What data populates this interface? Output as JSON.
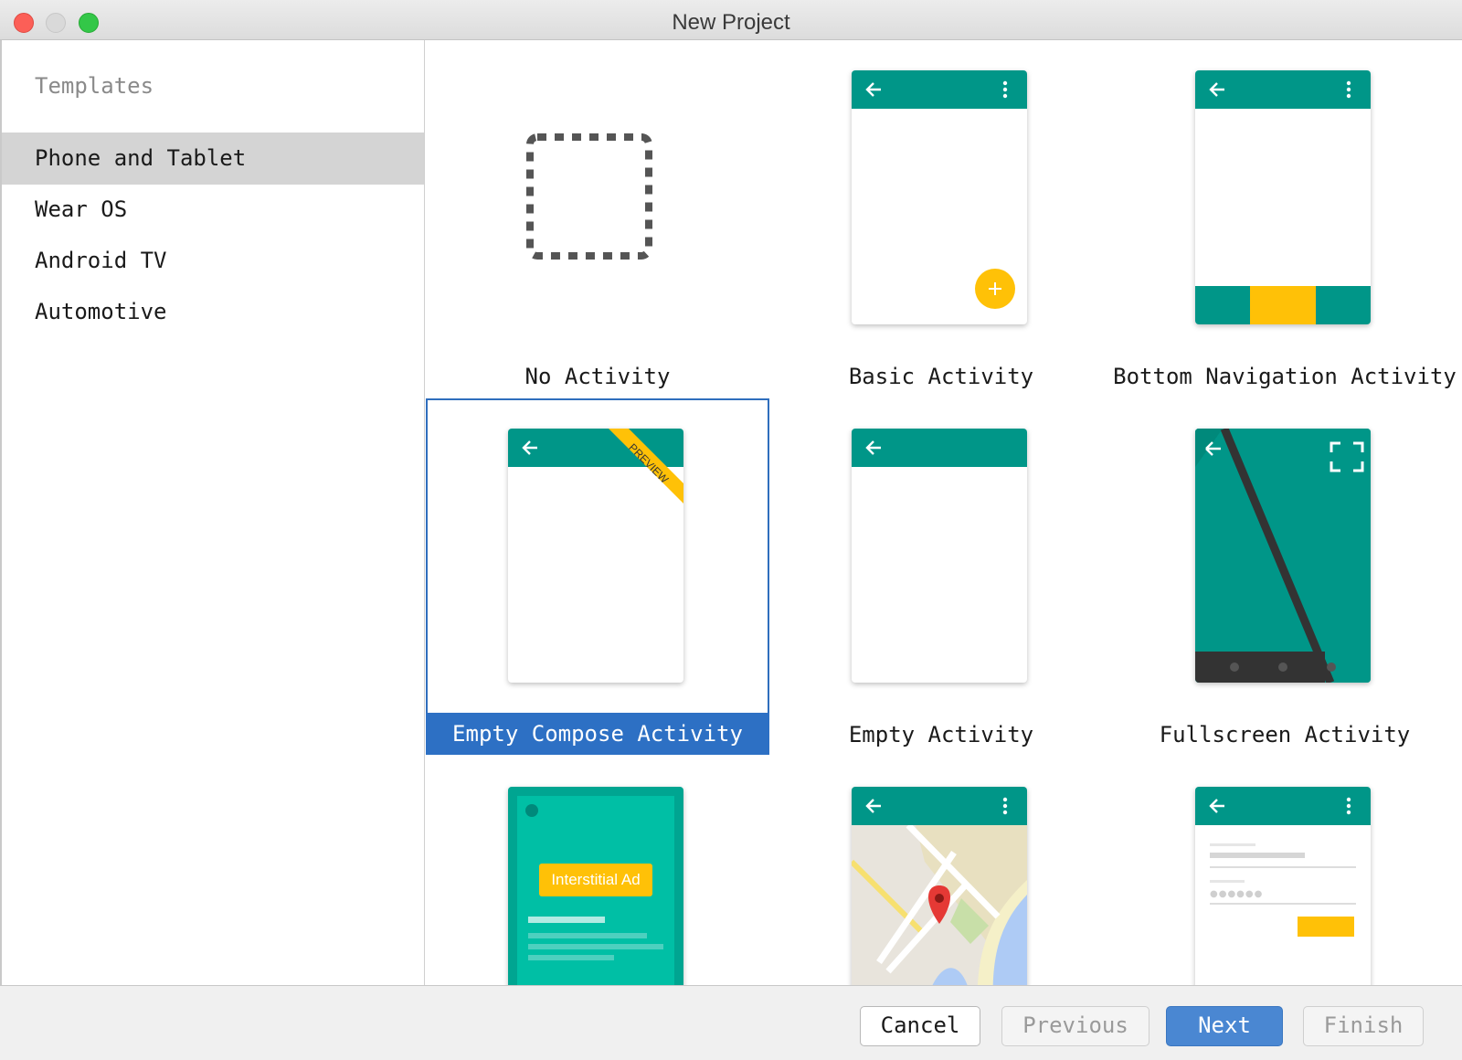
{
  "window": {
    "title": "New Project"
  },
  "sidebar": {
    "heading": "Templates",
    "items": [
      {
        "label": "Phone and Tablet",
        "selected": true
      },
      {
        "label": "Wear OS",
        "selected": false
      },
      {
        "label": "Android TV",
        "selected": false
      },
      {
        "label": "Automotive",
        "selected": false
      }
    ]
  },
  "templates": [
    {
      "label": "No Activity"
    },
    {
      "label": "Basic Activity"
    },
    {
      "label": "Bottom Navigation Activity"
    },
    {
      "label": "Empty Compose Activity",
      "selected": true,
      "badge": "PREVIEW"
    },
    {
      "label": "Empty Activity"
    },
    {
      "label": "Fullscreen Activity"
    },
    {
      "label": "",
      "ad_label": "Interstitial Ad"
    },
    {
      "label": ""
    },
    {
      "label": ""
    }
  ],
  "footer": {
    "cancel": "Cancel",
    "previous": "Previous",
    "next": "Next",
    "finish": "Finish"
  },
  "colors": {
    "app_bar": "#009688",
    "accent": "#FFC107",
    "selection": "#2D70C4"
  }
}
